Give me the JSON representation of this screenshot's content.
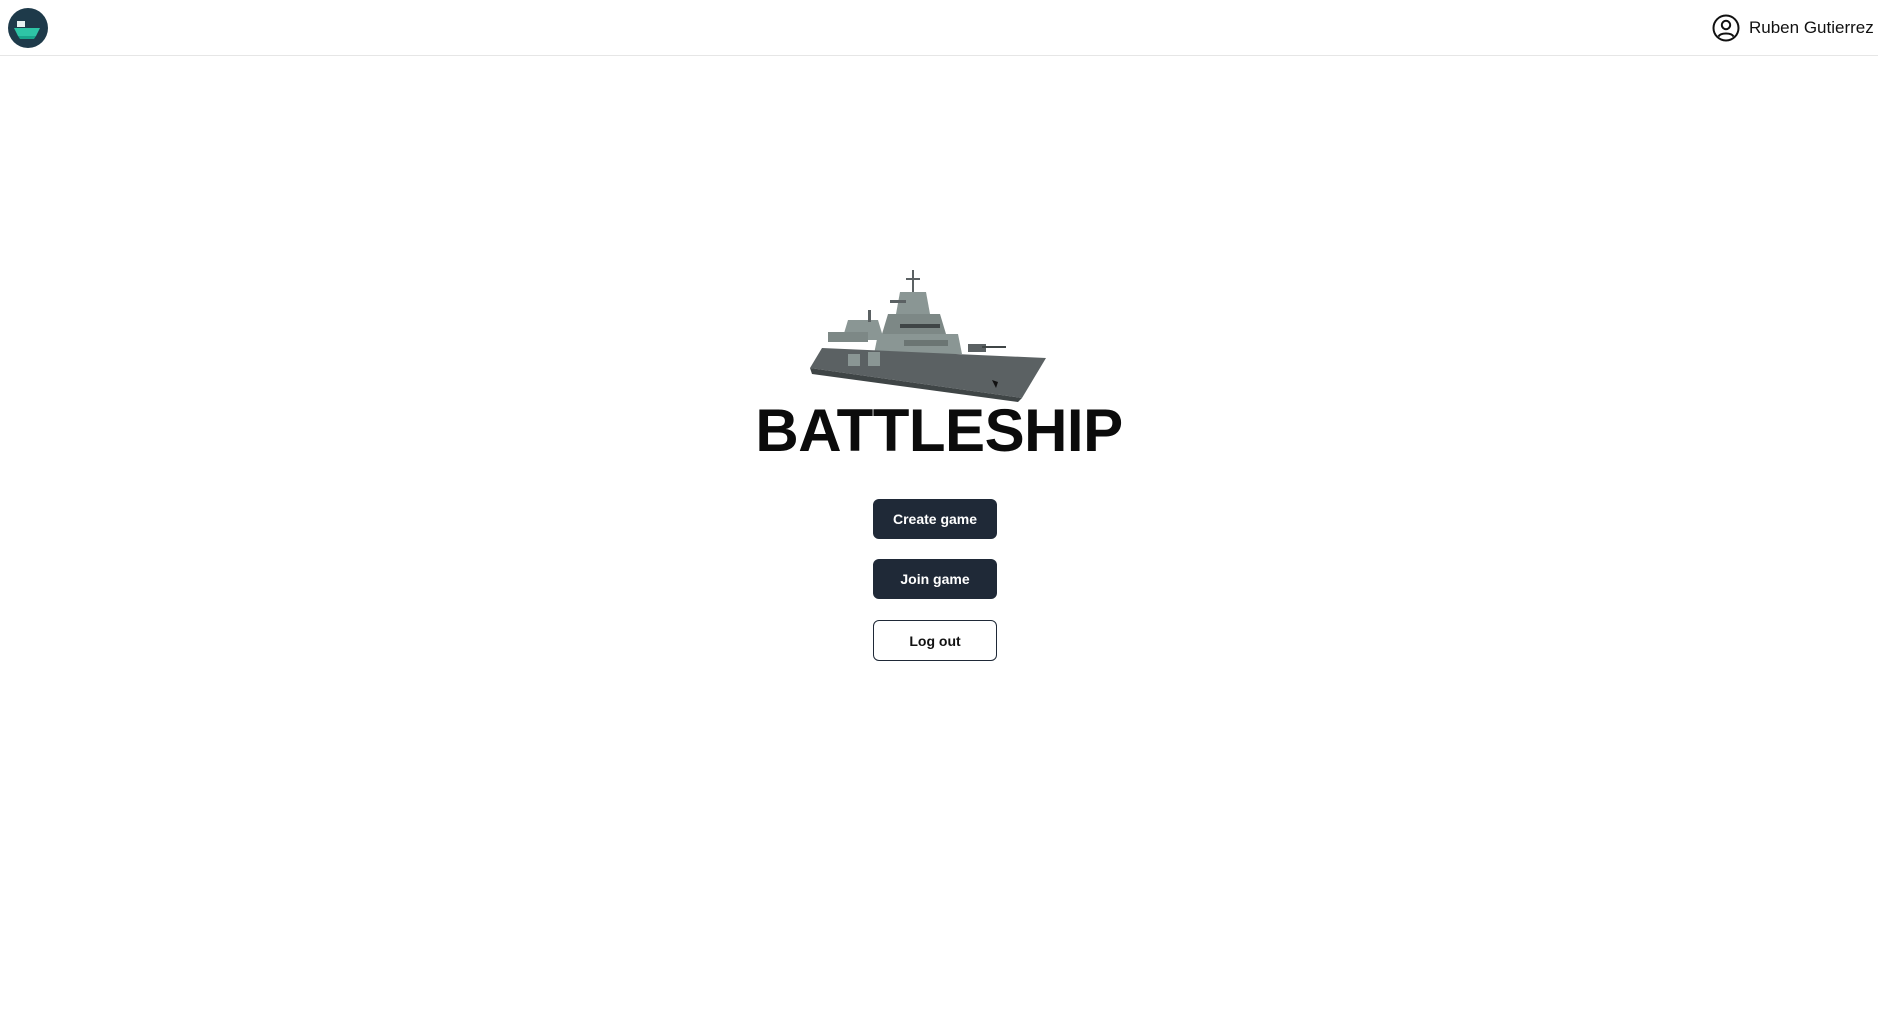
{
  "header": {
    "logo_icon": "battleship-logo-icon",
    "user_icon": "user-circle-icon",
    "user_name": "Ruben Gutierrez"
  },
  "main": {
    "image_icon": "battleship-ship-illustration",
    "title": "BATTLESHIP",
    "buttons": {
      "create": "Create game",
      "join": "Join game",
      "logout": "Log out"
    }
  },
  "colors": {
    "button_dark": "#1f2937",
    "logo_bg": "#1e3a4a",
    "logo_ship": "#2ec4a6",
    "ship_hull": "#5b6163",
    "ship_super": "#8a9694"
  }
}
